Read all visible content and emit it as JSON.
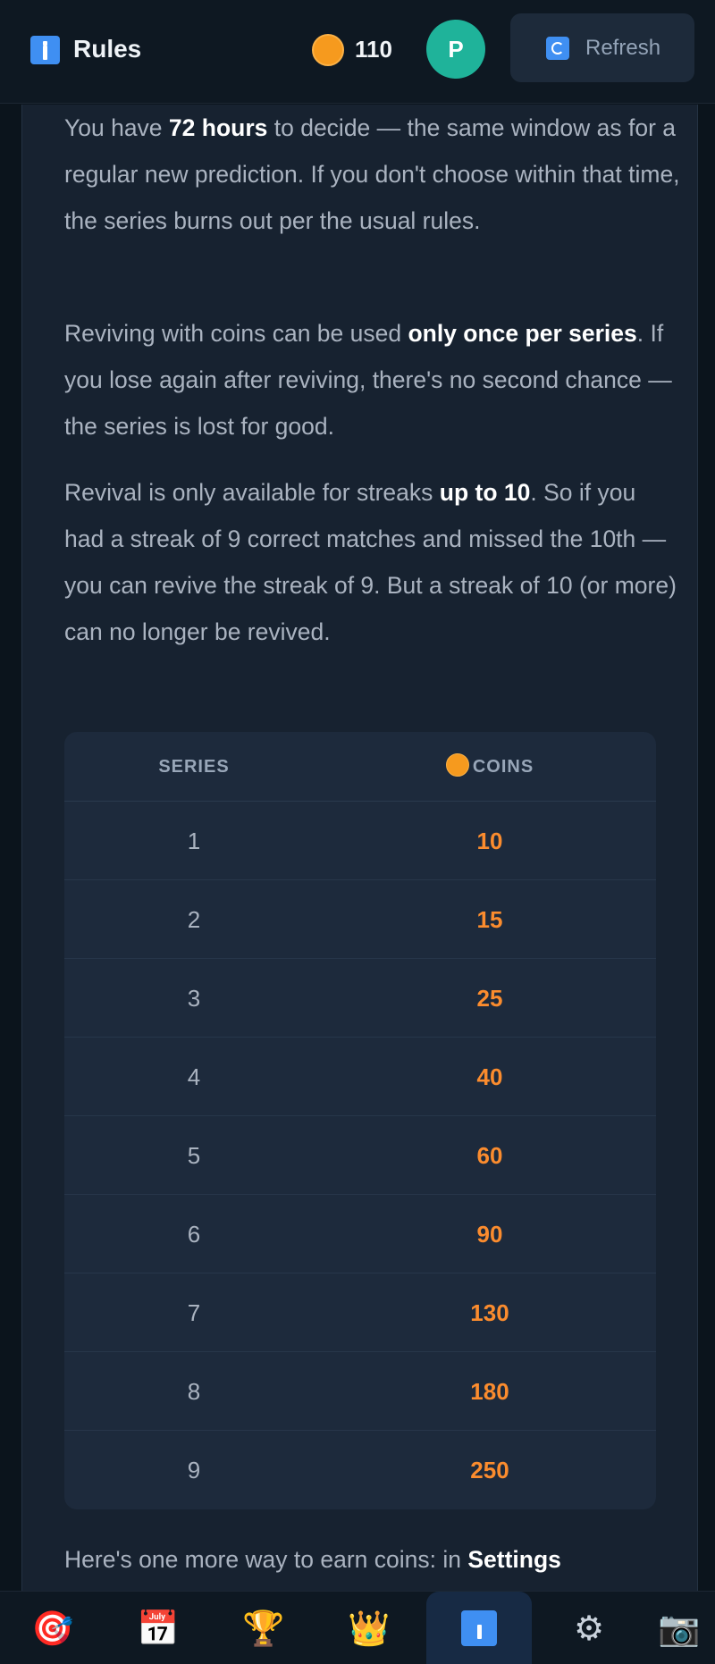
{
  "header": {
    "title": "Rules",
    "coin_balance": "110",
    "avatar_initial": "P",
    "refresh_label": "Refresh"
  },
  "content": {
    "para1": {
      "a": "You have ",
      "b": "72 hours",
      "c": " to decide — the same window as for a regular new prediction. If you don't choose within that time, the series burns out per the usual rules."
    },
    "para2": {
      "a": "Reviving with coins can be used ",
      "b": "only once per series",
      "c": ". If you lose again after reviving, there's no second chance — the series is lost for good."
    },
    "para3": {
      "a": "Revival is only available for streaks ",
      "b": "up to 10",
      "c": ". So if you had a streak of 9 correct matches and missed the 10th — you can revive the streak of 9. But a streak of 10 (or more) can no longer be revived."
    },
    "para4": {
      "a": "Here's one more way to earn coins: in ",
      "b": "Settings"
    }
  },
  "table": {
    "headers": {
      "series": "SERIES",
      "coins": "COINS"
    },
    "rows": [
      {
        "series": "1",
        "coins": "10"
      },
      {
        "series": "2",
        "coins": "15"
      },
      {
        "series": "3",
        "coins": "25"
      },
      {
        "series": "4",
        "coins": "40"
      },
      {
        "series": "5",
        "coins": "60"
      },
      {
        "series": "6",
        "coins": "90"
      },
      {
        "series": "7",
        "coins": "130"
      },
      {
        "series": "8",
        "coins": "180"
      },
      {
        "series": "9",
        "coins": "250"
      }
    ]
  },
  "nav": {
    "items": [
      {
        "icon": "target-icon",
        "glyph": "🎯"
      },
      {
        "icon": "calendar-icon",
        "glyph": "📅"
      },
      {
        "icon": "trophy-icon",
        "glyph": "🏆"
      },
      {
        "icon": "crown-icon",
        "glyph": "👑"
      },
      {
        "icon": "info-icon",
        "glyph": "ℹ",
        "active": true
      },
      {
        "icon": "gear-icon",
        "glyph": "⚙"
      },
      {
        "icon": "camera-icon",
        "glyph": "📷"
      }
    ]
  },
  "colors": {
    "accent_blue": "#3f8ff2",
    "coin_orange": "#fb8c2e",
    "avatar_teal": "#1fb39a",
    "background": "#0b141c",
    "panel": "#172230"
  }
}
